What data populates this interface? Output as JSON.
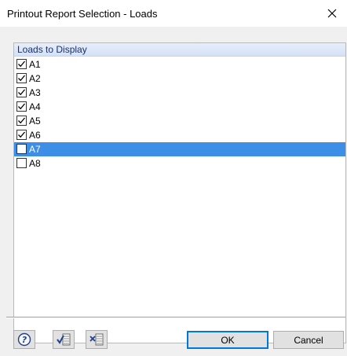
{
  "window": {
    "title": "Printout Report Selection - Loads",
    "close_glyph": "✕"
  },
  "group": {
    "header": "Loads to Display"
  },
  "loads": [
    {
      "label": "A1",
      "checked": true,
      "selected": false
    },
    {
      "label": "A2",
      "checked": true,
      "selected": false
    },
    {
      "label": "A3",
      "checked": true,
      "selected": false
    },
    {
      "label": "A4",
      "checked": true,
      "selected": false
    },
    {
      "label": "A5",
      "checked": true,
      "selected": false
    },
    {
      "label": "A6",
      "checked": true,
      "selected": false
    },
    {
      "label": "A7",
      "checked": false,
      "selected": true
    },
    {
      "label": "A8",
      "checked": false,
      "selected": false
    }
  ],
  "buttons": {
    "ok": "OK",
    "cancel": "Cancel"
  },
  "icons": [
    "help-icon",
    "check-all-icon",
    "uncheck-all-icon"
  ],
  "colors": {
    "selection": "#3d8ee6",
    "header_text": "#17306d",
    "ok_border": "#0078d7"
  }
}
